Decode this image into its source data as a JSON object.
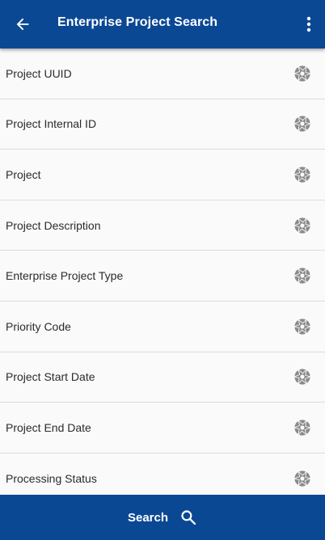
{
  "header": {
    "title": "Enterprise Project Search",
    "back_icon": "arrow-left-icon",
    "menu_icon": "more-vertical-icon"
  },
  "fields": [
    {
      "label": "Project UUID",
      "icon": "aperture-icon"
    },
    {
      "label": "Project Internal ID",
      "icon": "aperture-icon"
    },
    {
      "label": "Project",
      "icon": "aperture-icon"
    },
    {
      "label": "Project Description",
      "icon": "aperture-icon"
    },
    {
      "label": "Enterprise Project Type",
      "icon": "aperture-icon"
    },
    {
      "label": "Priority Code",
      "icon": "aperture-icon"
    },
    {
      "label": "Project Start Date",
      "icon": "aperture-icon"
    },
    {
      "label": "Project End Date",
      "icon": "aperture-icon"
    },
    {
      "label": "Processing Status",
      "icon": "aperture-icon"
    }
  ],
  "footer": {
    "search_label": "Search",
    "search_icon": "search-icon"
  },
  "colors": {
    "brand": "#0b4894",
    "icon_gray": "#8a8a8a",
    "background": "#fafafa"
  }
}
